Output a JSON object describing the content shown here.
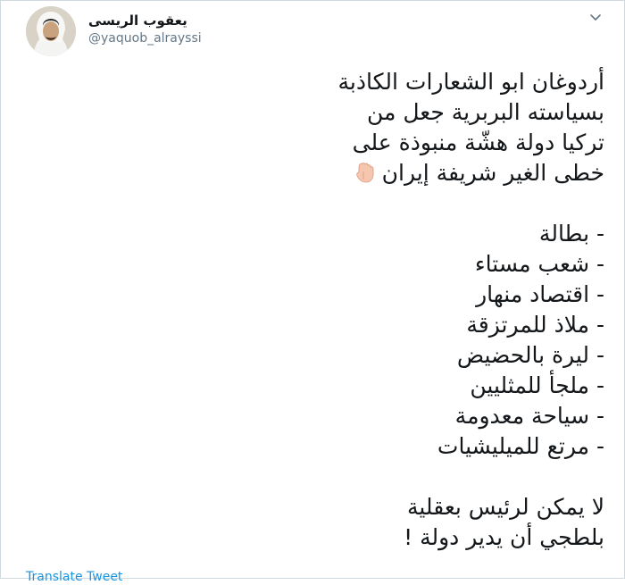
{
  "author": {
    "display_name": "يعقوب الريسى",
    "handle": "@yaquob_alrayssi",
    "avatar_icon": "avatar-photo"
  },
  "menu": {
    "caret_icon": "chevron-down-icon"
  },
  "tweet": {
    "intro_lines": [
      "أردوغان ابو الشعارات الكاذبة",
      "بسياسته البربرية جعل من",
      "تركيا دولة هشّة منبوذة على",
      "خطى الغير شريفة إيران"
    ],
    "emoji_icon": "backhand-index-pointing-down-icon",
    "list_items": [
      "- بطالة",
      "- شعب مستاء",
      "- اقتصاد منهار",
      "- ملاذ للمرتزقة",
      "- ليرة بالحضيض",
      "- ملجأ للمثليين",
      "- سياحة معدومة",
      "- مرتع للميليشيات"
    ],
    "closing_lines": [
      "لا يمكن لرئيس بعقلية",
      "بلطجي أن يدير دولة !"
    ]
  },
  "translate_link": "Translate Tweet",
  "colors": {
    "text": "#14171a",
    "secondary": "#657786",
    "link": "#1b95e0"
  }
}
